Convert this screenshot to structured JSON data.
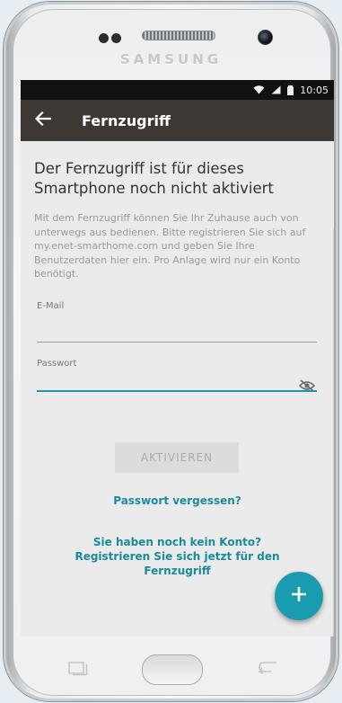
{
  "device": {
    "brand": "SAMSUNG"
  },
  "statusbar": {
    "time": "10:05"
  },
  "appbar": {
    "title": "Fernzugriff"
  },
  "content": {
    "heading": "Der Fernzugriff ist für dieses Smartphone noch nicht aktiviert",
    "description": "Mit dem Fernzugriff können Sie Ihr Zuhause auch von unterwegs aus bedienen. Bitte registrieren Sie sich auf my.enet-smarthome.com und geben Sie Ihre Benutzerdaten hier ein. Pro Anlage wird nur ein Konto benötigt.",
    "email": {
      "label": "E-Mail",
      "value": ""
    },
    "password": {
      "label": "Passwort",
      "value": ""
    },
    "activate_label": "AKTIVIEREN",
    "forgot_label": "Passwort vergessen?",
    "register_line1": "Sie haben noch kein Konto?",
    "register_line2": "Registrieren Sie sich jetzt für den",
    "register_line3": "Fernzugriff"
  },
  "fab": {
    "icon": "plus-icon"
  },
  "colors": {
    "appbar": "#3e3834",
    "accent": "#1a9bb0",
    "link": "#1a8a9e",
    "screen_bg": "#ebebeb"
  }
}
